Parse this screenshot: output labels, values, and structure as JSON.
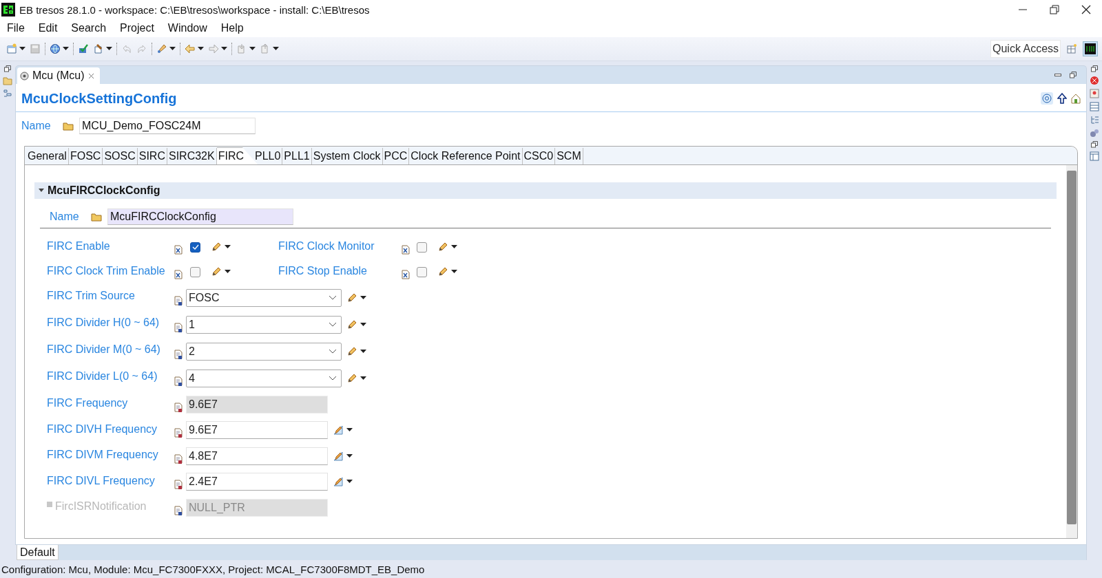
{
  "window": {
    "title": "EB tresos 28.1.0 - workspace: C:\\EB\\tresos\\workspace - install: C:\\EB\\tresos"
  },
  "menu": [
    {
      "label": "File"
    },
    {
      "label": "Edit"
    },
    {
      "label": "Search"
    },
    {
      "label": "Project"
    },
    {
      "label": "Window"
    },
    {
      "label": "Help"
    }
  ],
  "quick_access": {
    "placeholder": "Quick Access"
  },
  "editor_tab": {
    "label": "Mcu (Mcu)"
  },
  "editor": {
    "heading": "McuClockSettingConfig",
    "name": {
      "label": "Name",
      "value": "MCU_Demo_FOSC24M"
    },
    "tabs": [
      {
        "label": "General",
        "selected": false
      },
      {
        "label": "FOSC",
        "selected": false
      },
      {
        "label": "SOSC",
        "selected": false
      },
      {
        "label": "SIRC",
        "selected": false
      },
      {
        "label": "SIRC32K",
        "selected": false
      },
      {
        "label": "FIRC",
        "selected": true
      },
      {
        "label": "PLL0",
        "selected": false
      },
      {
        "label": "PLL1",
        "selected": false
      },
      {
        "label": "System Clock",
        "selected": false
      },
      {
        "label": "PCC",
        "selected": false
      },
      {
        "label": "Clock Reference Point",
        "selected": false
      },
      {
        "label": "CSC0",
        "selected": false
      },
      {
        "label": "SCM",
        "selected": false
      }
    ],
    "section": {
      "title": "McuFIRCClockConfig",
      "expanded": true,
      "name": {
        "label": "Name",
        "value": "McuFIRCClockConfig"
      },
      "params": [
        {
          "kind": "checkbox",
          "label": "FIRC Enable",
          "checked": true
        },
        {
          "kind": "checkbox",
          "label": "FIRC Clock Monitor",
          "checked": false
        },
        {
          "kind": "checkbox",
          "label": "FIRC Clock Trim Enable",
          "checked": false
        },
        {
          "kind": "checkbox",
          "label": "FIRC Stop Enable",
          "checked": false
        },
        {
          "kind": "combo",
          "label": "FIRC Trim Source",
          "value": "FOSC"
        },
        {
          "kind": "combo",
          "label": "FIRC Divider H(0 ~ 64)",
          "value": "1"
        },
        {
          "kind": "combo",
          "label": "FIRC Divider M(0 ~ 64)",
          "value": "2"
        },
        {
          "kind": "combo",
          "label": "FIRC Divider L(0 ~ 64)",
          "value": "4"
        },
        {
          "kind": "text",
          "label": "FIRC Frequency",
          "value": "9.6E7",
          "editable": false,
          "disabled": false
        },
        {
          "kind": "text",
          "label": "FIRC DIVH Frequency",
          "value": "9.6E7",
          "editable": true,
          "disabled": false
        },
        {
          "kind": "text",
          "label": "FIRC DIVM Frequency",
          "value": "4.8E7",
          "editable": true,
          "disabled": false
        },
        {
          "kind": "text",
          "label": "FIRC DIVL Frequency",
          "value": "2.4E7",
          "editable": true,
          "disabled": false
        },
        {
          "kind": "text",
          "label": "FircISRNotification",
          "value": "NULL_PTR",
          "editable": false,
          "disabled": true
        }
      ]
    }
  },
  "page_tabs": [
    {
      "label": "Default",
      "selected": true
    }
  ],
  "status_bar": "Configuration: Mcu, Module: Mcu_FC7300FXXX, Project: MCAL_FC7300F8MDT_EB_Demo"
}
